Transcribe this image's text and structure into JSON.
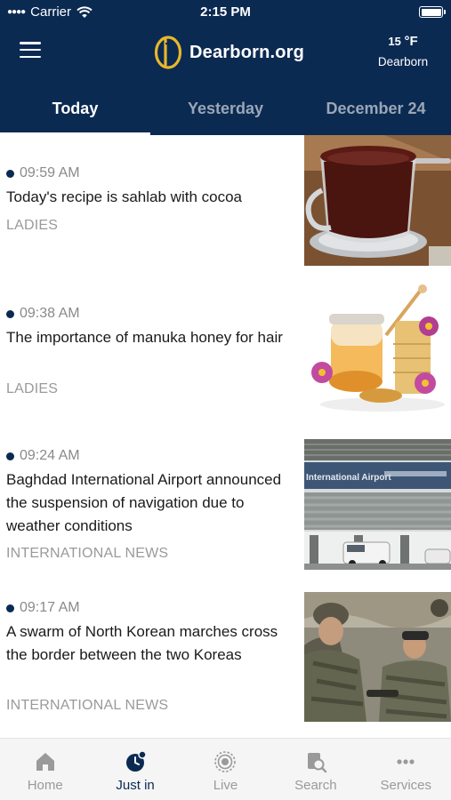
{
  "status_bar": {
    "carrier": "Carrier",
    "time": "2:15 PM",
    "battery_level": 1.0
  },
  "header": {
    "logo_text": "Dearborn.org",
    "weather": {
      "temp": "15",
      "unit": "°F",
      "city": "Dearborn"
    },
    "menu_icon": "hamburger-menu-icon"
  },
  "tabs": [
    {
      "label": "Today",
      "active": true
    },
    {
      "label": "Yesterday",
      "active": false
    },
    {
      "label": "December 24",
      "active": false
    }
  ],
  "news": [
    {
      "time": "09:59 AM",
      "title": "Today's recipe is sahlab with cocoa",
      "category": "LADIES",
      "image": "cocoa-cup"
    },
    {
      "time": "09:38 AM",
      "title": "The importance of manuka honey for hair",
      "category": "LADIES",
      "image": "honey-jar"
    },
    {
      "time": "09:24 AM",
      "title": "Baghdad International Airport announced the suspension of navigation due to weather conditions",
      "category": "INTERNATIONAL NEWS",
      "image": "airport-building",
      "image_sign": "International Airport"
    },
    {
      "time": "09:17 AM",
      "title": "A swarm of North Korean marches cross the border between the two Koreas",
      "category": "INTERNATIONAL NEWS",
      "image": "soldiers"
    }
  ],
  "bottom_nav": [
    {
      "label": "Home",
      "icon": "home-icon",
      "active": false
    },
    {
      "label": "Just in",
      "icon": "clock-icon",
      "active": true
    },
    {
      "label": "Live",
      "icon": "live-icon",
      "active": false
    },
    {
      "label": "Search",
      "icon": "search-icon",
      "active": false
    },
    {
      "label": "Services",
      "icon": "more-icon",
      "active": false
    }
  ],
  "colors": {
    "brand": "#0b2a52",
    "logo_accent": "#e8b72a",
    "inactive": "#9a9a9a"
  }
}
